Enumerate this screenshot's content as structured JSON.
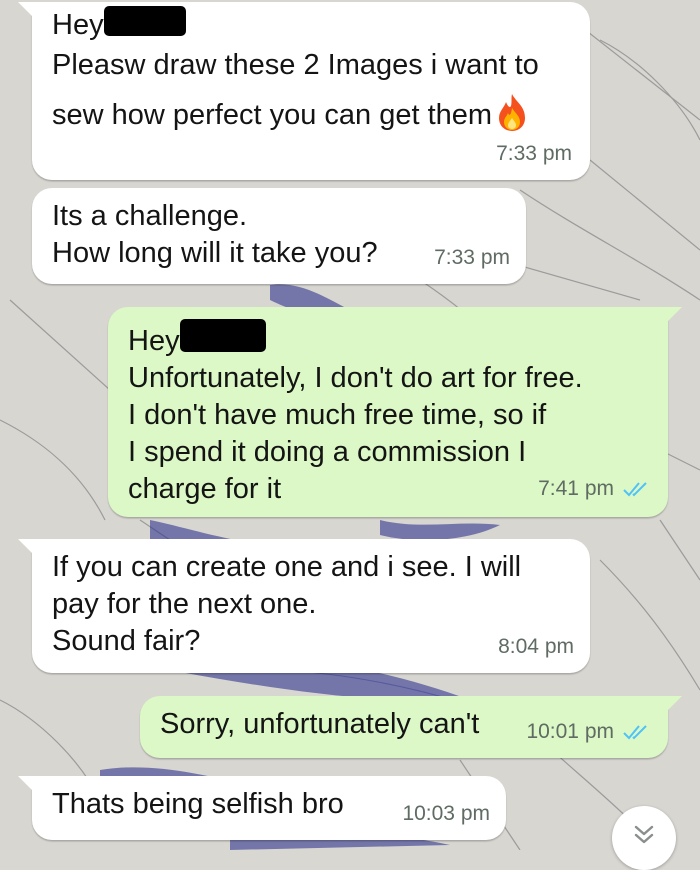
{
  "messages": [
    {
      "direction": "incoming",
      "lines": [
        "Hey",
        "Pleasw draw these 2 Images i want to",
        "sew how perfect you can get them"
      ],
      "redacted_name": true,
      "emoji": "fire-emoji",
      "time": "7:33 pm"
    },
    {
      "direction": "incoming",
      "lines": [
        "Its a challenge.",
        "How long will it take you?"
      ],
      "time": "7:33 pm"
    },
    {
      "direction": "outgoing",
      "lines": [
        "Hey",
        "Unfortunately, I don't do art for free.",
        "I don't have much free time, so if",
        "I spend it doing a commission I",
        "charge for it"
      ],
      "redacted_name": true,
      "time": "7:41 pm",
      "status": "read",
      "status_icon": "double-check-icon"
    },
    {
      "direction": "incoming",
      "lines": [
        "If you can create one and i see. I will",
        "pay for the next one.",
        "Sound fair?"
      ],
      "time": "8:04 pm"
    },
    {
      "direction": "outgoing",
      "lines": [
        "Sorry, unfortunately can't"
      ],
      "time": "10:01 pm",
      "status": "read",
      "status_icon": "double-check-icon"
    },
    {
      "direction": "incoming",
      "lines": [
        "Thats being selfish bro"
      ],
      "time": "10:03 pm"
    }
  ],
  "scroll_button": {
    "icon": "double-chevron-down-icon"
  },
  "colors": {
    "incoming_bubble": "#ffffff",
    "outgoing_bubble": "#dcf8c6",
    "read_ticks": "#4fc3f7",
    "timestamp": "#5f6b63"
  }
}
